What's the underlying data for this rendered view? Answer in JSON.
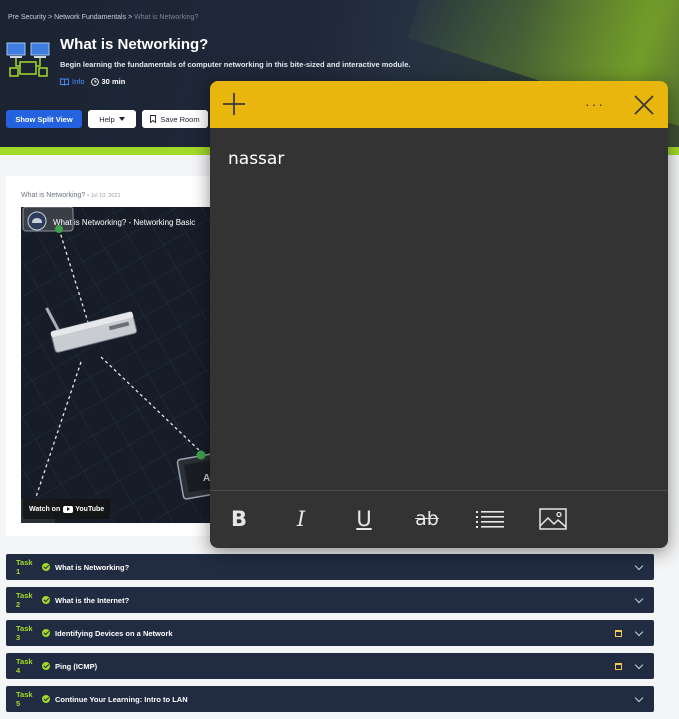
{
  "breadcrumb": {
    "items": [
      "Pre Security",
      "Network Fundamentals",
      "What is Networking?"
    ],
    "separator": ">"
  },
  "room": {
    "title": "What is Networking?",
    "subtitle": "Begin learning the fundamentals of computer networking in this bite-sized and interactive module.",
    "info_label": "Info",
    "duration": "30 min"
  },
  "actions": {
    "split_view": "Show Split View",
    "help": "Help",
    "save_room": "Save Room"
  },
  "video": {
    "caption_title": "What is Networking?",
    "caption_date": "Jul 10, 2021",
    "title": "What is Networking? - Networking Basic",
    "watch_on": "Watch on",
    "youtube": "YouTube",
    "screen_label": "Al"
  },
  "tasks": [
    {
      "num": "Task 1",
      "name": "What is Networking?",
      "has_calendar": false
    },
    {
      "num": "Task 2",
      "name": "What is the Internet?",
      "has_calendar": false
    },
    {
      "num": "Task 3",
      "name": "Identifying Devices on a Network",
      "has_calendar": true
    },
    {
      "num": "Task 4",
      "name": "Ping (ICMP)",
      "has_calendar": true
    },
    {
      "num": "Task 5",
      "name": "Continue Your Learning: Intro to LAN",
      "has_calendar": false
    }
  ],
  "note": {
    "text": "nassar",
    "more_label": "···",
    "toolbar": {
      "bold": "B",
      "italic": "I",
      "underline": "U",
      "strikethrough": "ab"
    },
    "accent_color": "#e8b60d",
    "background_color": "#333333"
  },
  "colors": {
    "header_bg": "#1c2433",
    "accent_green": "#a3d929",
    "primary_blue": "#2462e0",
    "task_bg": "#212c42"
  },
  "icons": {
    "info": "info-book-icon",
    "duration": "clock-icon",
    "help": "chevron-down-icon",
    "save": "bookmark-icon",
    "note_add": "plus-icon",
    "note_more": "ellipsis-icon",
    "note_close": "close-icon",
    "note_list": "list-icon",
    "note_image": "image-icon",
    "task_status": "check-circle-icon",
    "task_expand": "chevron-down-icon",
    "task_calendar": "calendar-icon"
  }
}
